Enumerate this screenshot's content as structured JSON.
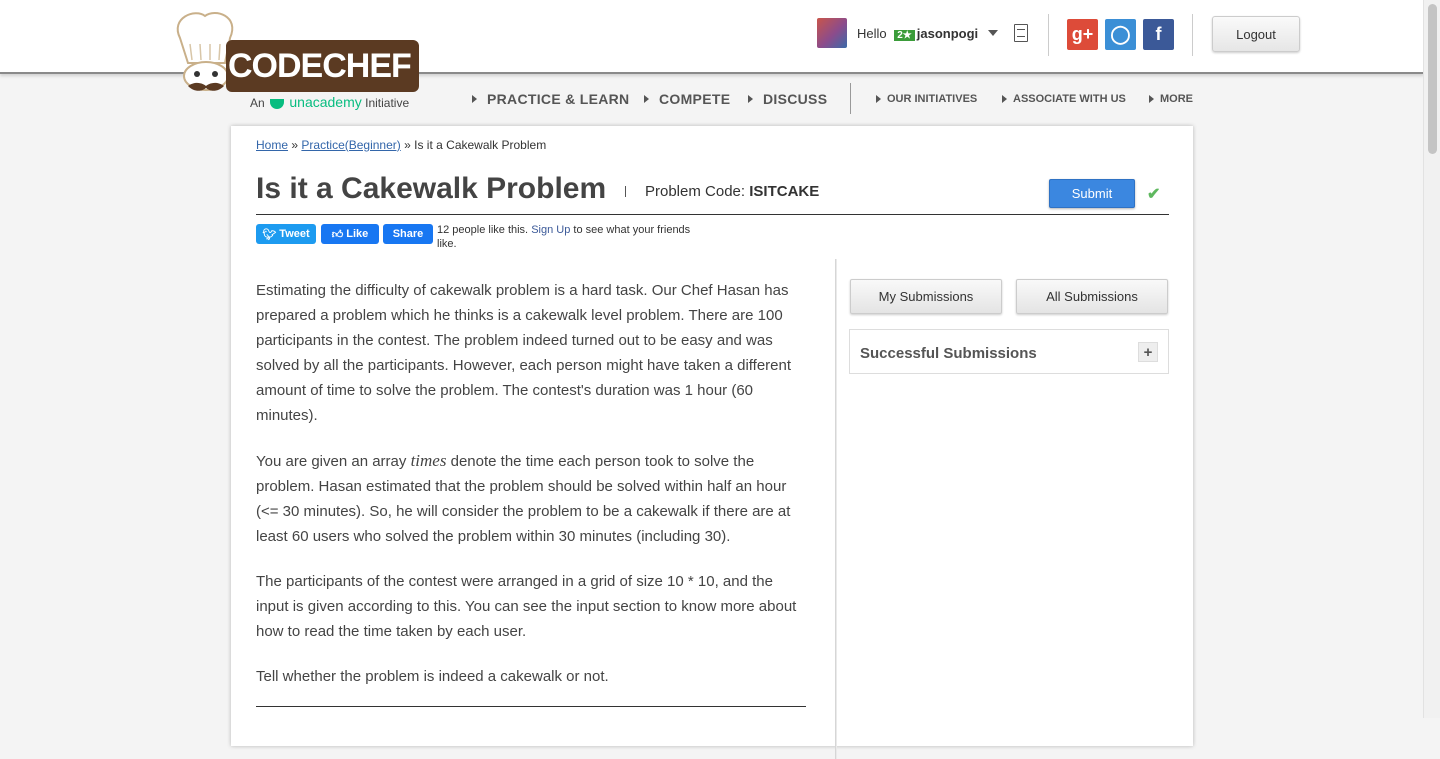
{
  "header": {
    "logo_text": "CODECHEF",
    "logo_tagline_prefix": "An",
    "logo_tagline_brand": "unacademy",
    "logo_tagline_suffix": "Initiative",
    "greeting": "Hello",
    "user_rating_badge": "2★",
    "username": "jasonpogi",
    "logout_label": "Logout",
    "social": [
      {
        "name": "google-plus",
        "glyph": "g+",
        "color": "#dd4b39"
      },
      {
        "name": "github",
        "glyph": "◯",
        "color": "#3b8fd6"
      },
      {
        "name": "facebook",
        "glyph": "f",
        "color": "#3b5998"
      }
    ]
  },
  "nav": {
    "main": [
      "PRACTICE & LEARN",
      "COMPETE",
      "DISCUSS"
    ],
    "secondary": [
      "OUR INITIATIVES",
      "ASSOCIATE WITH US",
      "MORE"
    ]
  },
  "breadcrumb": {
    "home": "Home",
    "separator": "»",
    "practice": "Practice(Beginner)",
    "current": "Is it a Cakewalk Problem"
  },
  "problem": {
    "title": "Is it a Cakewalk Problem",
    "code_label": "Problem Code:",
    "code": "ISITCAKE",
    "submit_label": "Submit",
    "paragraphs": {
      "p1": "Estimating the difficulty of cakewalk problem is a hard task. Our Chef Hasan has prepared a problem which he thinks is a cakewalk level problem. There are 100 participants in the contest. The problem indeed turned out to be easy and was solved by all the participants. However, each person might have taken a different amount of time to solve the problem. The contest's duration was 1 hour (60 minutes).",
      "p2_before": "You are given an array",
      "p2_var": "times",
      "p2_after": "denote the time each person took to solve the problem. Hasan estimated that the problem should be solved within half an hour (<= 30 minutes). So, he will consider the problem to be a cakewalk if there are at least 60 users who solved the problem within 30 minutes (including 30).",
      "p3": "The participants of the contest were arranged in a grid of size 10 * 10, and the input is given according to this. You can see the input section to know more about how to read the time taken by each user.",
      "p4": "Tell whether the problem is indeed a cakewalk or not."
    }
  },
  "social_share": {
    "tweet": "Tweet",
    "like": "Like",
    "share": "Share",
    "likes_text": "12 people like this.",
    "signup": "Sign Up",
    "signup_suffix": "to see what your friends like."
  },
  "sidebar": {
    "my_submissions": "My Submissions",
    "all_submissions": "All Submissions",
    "successful_submissions": "Successful Submissions",
    "expand_glyph": "+"
  }
}
